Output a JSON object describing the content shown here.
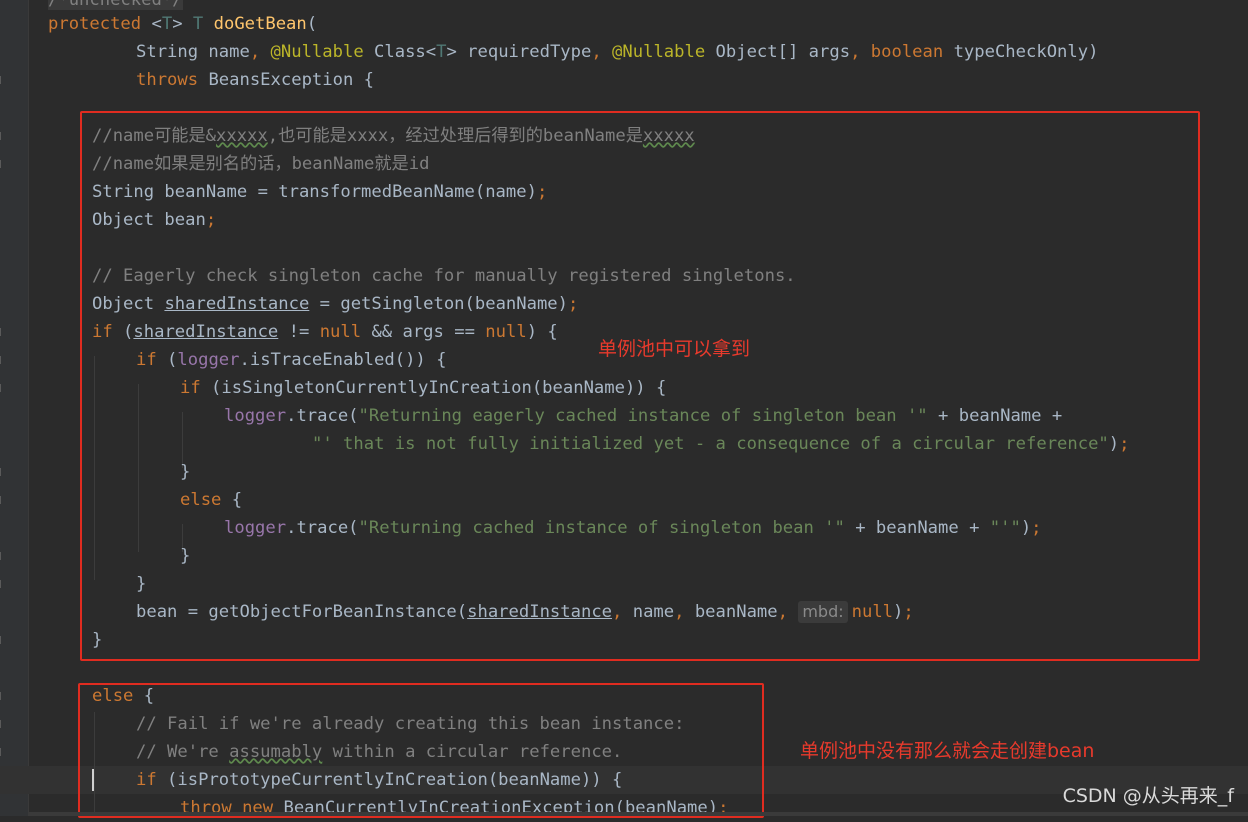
{
  "code_lines": {
    "l0": "/*unchecked*/",
    "l1_kw": "protected",
    "l1_a": " <",
    "l1_t": "T",
    "l1_b": "> ",
    "l1_t2": "T",
    "l1_c": " ",
    "l1_fn": "doGetBean",
    "l1_d": "(",
    "l2_a": "String name",
    "l2_s1": ",",
    "l2_ann1": " @Nullable",
    "l2_b": " Class<",
    "l2_t": "T",
    "l2_c": "> requiredType",
    "l2_s2": ",",
    "l2_ann2": " @Nullable",
    "l2_d": " Object[] args",
    "l2_s3": ",",
    "l2_kw": " boolean",
    "l2_e": " typeCheckOnly)",
    "l3_kw": "throws",
    "l3_a": " BeansException {",
    "l4_a": "//name可能是&",
    "l4_w1": "xxxxx",
    "l4_b": ",也可能是xxxx，经过处理后得到的beanName是",
    "l4_w2": "xxxxx",
    "l5": "//name如果是别名的话，beanName就是id",
    "l6_a": "String beanName = transformedBeanName(name)",
    "l6_s": ";",
    "l7_a": "Object bean",
    "l7_s": ";",
    "l8": "// Eagerly check singleton cache for manually registered singletons.",
    "l9_a": "Object ",
    "l9_u": "sharedInstance",
    "l9_b": " = getSingleton(beanName)",
    "l9_s": ";",
    "l10_kw": "if",
    "l10_a": " (",
    "l10_u": "sharedInstance",
    "l10_b": " != ",
    "l10_kw2": "null",
    "l10_c": " && args == ",
    "l10_kw3": "null",
    "l10_d": ") {",
    "l11_kw": "if",
    "l11_a": " (",
    "l11_f": "logger",
    "l11_b": ".isTraceEnabled()) {",
    "l12_kw": "if",
    "l12_a": " (isSingletonCurrentlyInCreation(beanName)) {",
    "l13_f": "logger",
    "l13_a": ".trace(",
    "l13_str": "\"Returning eagerly cached instance of singleton bean '\"",
    "l13_b": " + beanName +",
    "l14_str": "\"' that is not fully initialized yet - a consequence of a circular reference\"",
    "l14_a": ")",
    "l14_s": ";",
    "l15": "}",
    "l16_kw": "else",
    "l16_a": " {",
    "l17_f": "logger",
    "l17_a": ".trace(",
    "l17_str1": "\"Returning cached instance of singleton bean '\"",
    "l17_b": " + beanName + ",
    "l17_str2": "\"'\"",
    "l17_c": ")",
    "l17_s": ";",
    "l18": "}",
    "l19": "}",
    "l20_a": "bean = getObjectForBeanInstance(",
    "l20_u": "sharedInstance",
    "l20_s1": ",",
    "l20_b": " name",
    "l20_s2": ",",
    "l20_c": " beanName",
    "l20_s3": ",",
    "l20_hint": "mbd:",
    "l20_kw": "null",
    "l20_d": ")",
    "l20_s4": ";",
    "l21": "}",
    "l22_kw": "else",
    "l22_a": " {",
    "l23": "// Fail if we're already creating this bean instance:",
    "l24_a": "// We're ",
    "l24_w": "assumably",
    "l24_b": " within a circular reference.",
    "l25_kw": "if",
    "l25_a": " (isPrototypeCurrentlyInCreation(beanName)) {",
    "l26_kw": "throw new",
    "l26_a": " BeanCurrentlyInCreationException(beanName)",
    "l26_s": ";"
  },
  "annotations": {
    "note1": "单例池中可以拿到",
    "note2": "单例池中没有那么就会走创建bean"
  },
  "watermark": "CSDN @从头再来_f",
  "colors": {
    "background": "#2b2b2b",
    "keyword": "#cc7832",
    "method_decl": "#ffc66d",
    "annotation": "#bbb529",
    "comment": "#808080",
    "string": "#6a8759",
    "field": "#9876aa",
    "highlight_box": "#e02c20"
  }
}
